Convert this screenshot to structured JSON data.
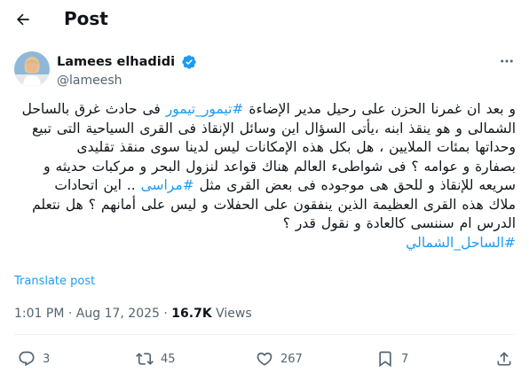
{
  "header": {
    "title": "Post"
  },
  "author": {
    "display_name": "Lamees elhadidi",
    "handle": "@lameesh"
  },
  "tweet": {
    "lines": [
      [
        {
          "t": "و بعد ان غمرنا الحزن على رحيل مدير الإضاءة  ",
          "h": false
        },
        {
          "t": "#تيمور_تيمور",
          "h": true
        },
        {
          "t": " فى حادث غرق بالساحل",
          "h": false
        }
      ],
      [
        {
          "t": "الشمالى و هو ينقذ ابنه ،يأتى السؤال اين وسائل الإنقاذ فى القرى السياحية التى تبيع",
          "h": false
        }
      ],
      [
        {
          "t": "وحداتها بمئات الملايين ، هل بكل هذه الإمكانات  ليس لدينا سوى منقذ  تقليدى",
          "h": false
        }
      ],
      [
        {
          "t": "بصفارة و عوامه ؟ فى شواطىء العالم هناك قواعد لنزول البحر و مركبات حديثه و",
          "h": false
        }
      ],
      [
        {
          "t": "سريعه للإنقاذ و للحق هى موجوده فى بعض القرى مثل ",
          "h": false
        },
        {
          "t": "#مراسى",
          "h": true
        },
        {
          "t": " .. اين اتحادات",
          "h": false
        }
      ],
      [
        {
          "t": "ملاك هذه القرى العظيمة الذين ينفقون على الحفلات و ليس على أمانهم ؟ هل نتعلم",
          "h": false
        }
      ],
      [
        {
          "t": "الدرس ام سننسى كالعادة و نقول قدر ؟",
          "h": false
        }
      ],
      [
        {
          "t": "#الساحل_الشمالي",
          "h": true
        }
      ]
    ],
    "translate_label": "Translate post"
  },
  "meta": {
    "time": "1:01 PM",
    "separator": " · ",
    "date": "Aug 17, 2025",
    "views_count": "16.7K",
    "views_label": " Views"
  },
  "actions": {
    "replies": "3",
    "reposts": "45",
    "likes": "267",
    "bookmarks": "7"
  },
  "colors": {
    "accent": "#1d9bf0",
    "text": "#0f1419",
    "secondary": "#536471",
    "divider": "#eff3f4"
  },
  "icons": {
    "back": "arrow-left-icon",
    "verified": "verified-badge-icon",
    "more": "more-horizontal-icon",
    "reply": "reply-icon",
    "repost": "repost-icon",
    "like": "heart-icon",
    "bookmark": "bookmark-icon",
    "share": "share-icon"
  }
}
